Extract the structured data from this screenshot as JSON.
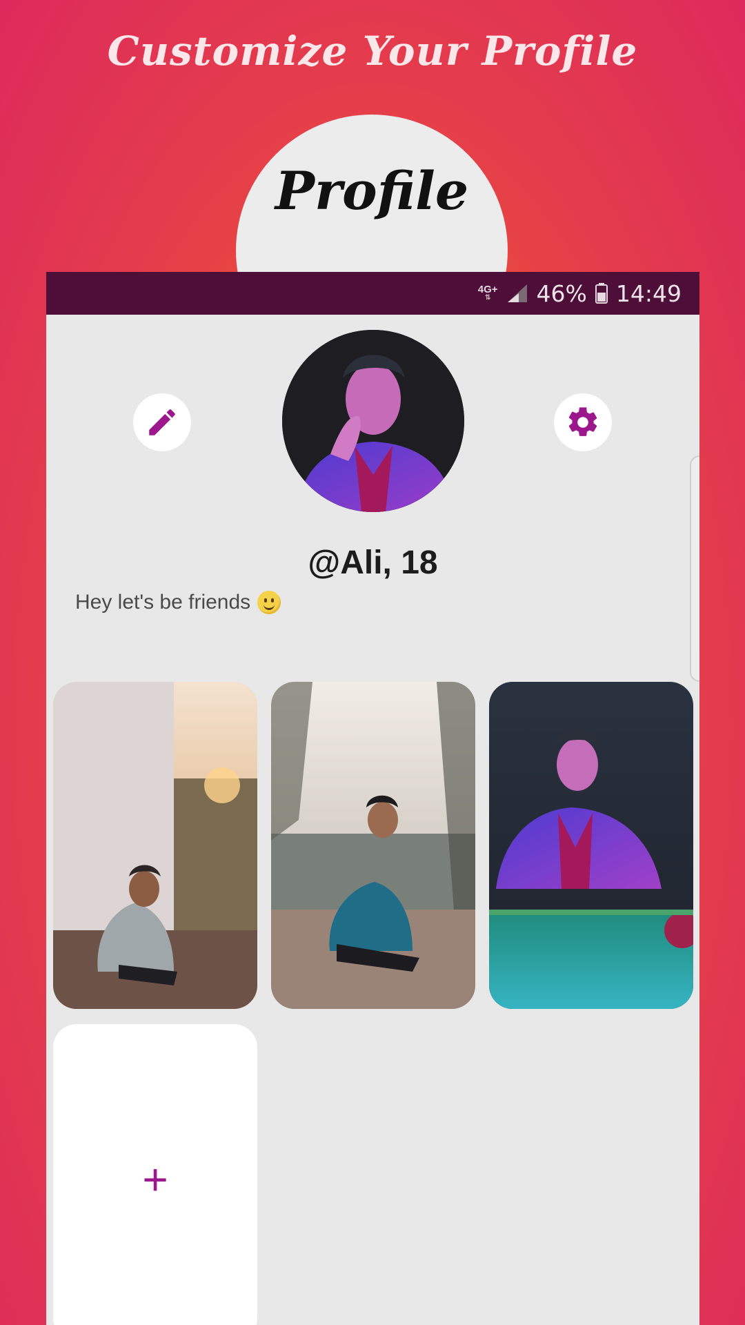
{
  "promo": {
    "title": "Customize Your Profile",
    "tab_label": "Profile"
  },
  "status_bar": {
    "network": "4G+",
    "battery_percent": "46%",
    "time": "14:49"
  },
  "profile": {
    "username": "@Ali, 18",
    "bio": "Hey let's be friends",
    "bio_emoji": "slightly-smiling-face"
  },
  "actions": {
    "edit_icon": "pencil-icon",
    "settings_icon": "gear-icon",
    "add_photo": "+"
  },
  "photos": [
    {
      "scene": "man crouching by white wall at sunset"
    },
    {
      "scene": "man in denim jacket crouching on brick street"
    },
    {
      "scene": "man in purple light at pool table"
    }
  ],
  "colors": {
    "accent": "#9c178c",
    "status_bar": "#4d0e38",
    "screen_bg": "#e8e8e8"
  }
}
